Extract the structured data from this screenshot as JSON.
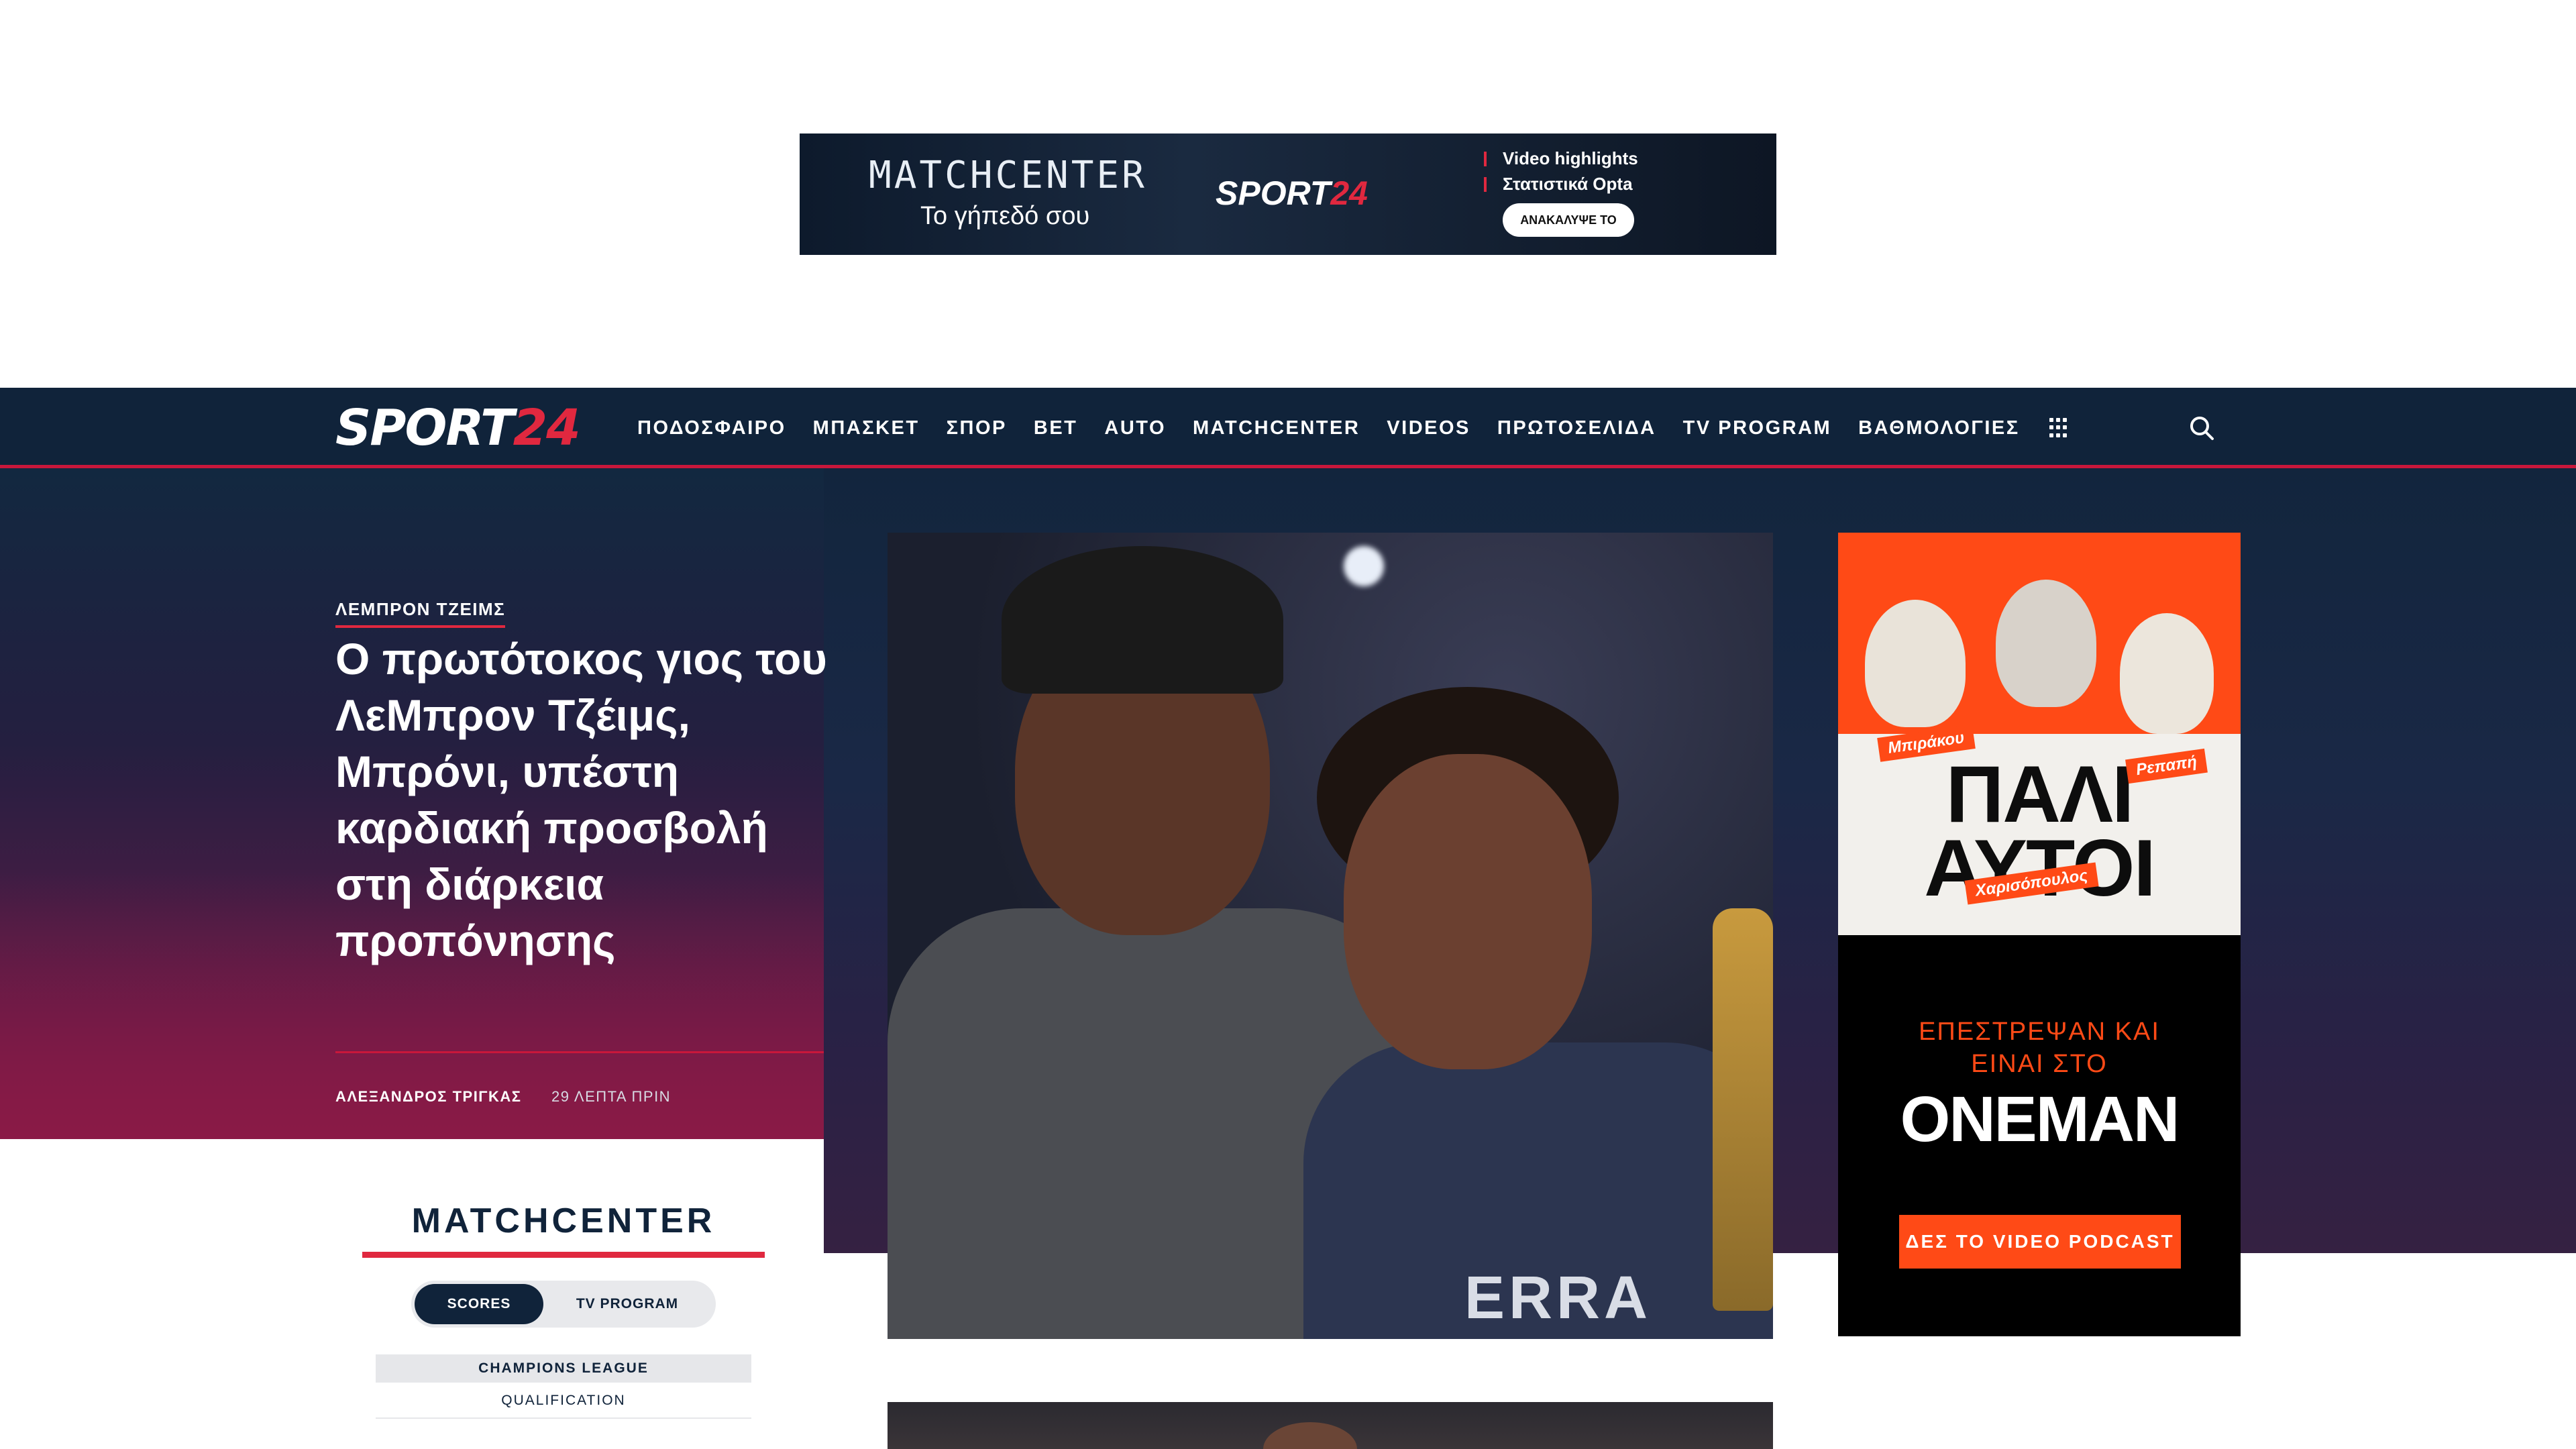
{
  "top_ad": {
    "title": "MATCHCENTER",
    "subtitle": "Το γήπεδό σου",
    "logo_main": "SPORT",
    "logo_accent": "24",
    "bullets": [
      "Video highlights",
      "Στατιστικά Opta"
    ],
    "button": "ΑΝΑΚΑΛΥΨΕ ΤΟ"
  },
  "header": {
    "logo_main": "SPORT",
    "logo_accent": "24",
    "nav": [
      "ΠΟΔΟΣΦΑΙΡΟ",
      "ΜΠΑΣΚΕΤ",
      "ΣΠΟΡ",
      "BET",
      "AUTO",
      "MATCHCENTER",
      "VIDEOS",
      "ΠΡΩΤΟΣΕΛΙΔΑ",
      "TV PROGRAM",
      "ΒΑΘΜΟΛΟΓΙΕΣ"
    ],
    "grid_icon": "grid-menu-icon",
    "search_icon": "search-icon"
  },
  "hero": {
    "kicker": "ΛΕΜΠΡΟΝ ΤΖΕΙΜΣ",
    "headline": "Ο πρωτότοκος γιος του ΛεΜπρον Τζέιμς, Μπρόνι, υπέστη καρδιακή προσβολή στη διάρκεια προπόνησης",
    "author": "ΑΛΕΞΑΝΔΡΟΣ ΤΡΙΓΚΑΣ",
    "time": "29 ΛΕΠΤΑ ΠΡΙΝ",
    "image_jersey_text": "ERRA"
  },
  "side_ad": {
    "title": "ΠΑΛΙ ΑΥΤΟΙ",
    "tags": [
      "Μπιράκου",
      "Ρεπαπή",
      "Χαρισόπουλος"
    ],
    "line": "ΕΠΕΣΤΡΕΨΑΝ ΚΑΙ ΕΙΝΑΙ ΣΤΟ",
    "brand": "ONEMAN",
    "cta": "ΔΕΣ ΤΟ VIDEO PODCAST"
  },
  "matchcenter": {
    "title": "MATCHCENTER",
    "tabs": [
      "SCORES",
      "TV PROGRAM"
    ],
    "league": "CHAMPIONS LEAGUE",
    "stage": "QUALIFICATION"
  },
  "colors": {
    "navy": "#10233a",
    "accent_red": "#e0283f",
    "ad_orange": "#ff4a16"
  }
}
